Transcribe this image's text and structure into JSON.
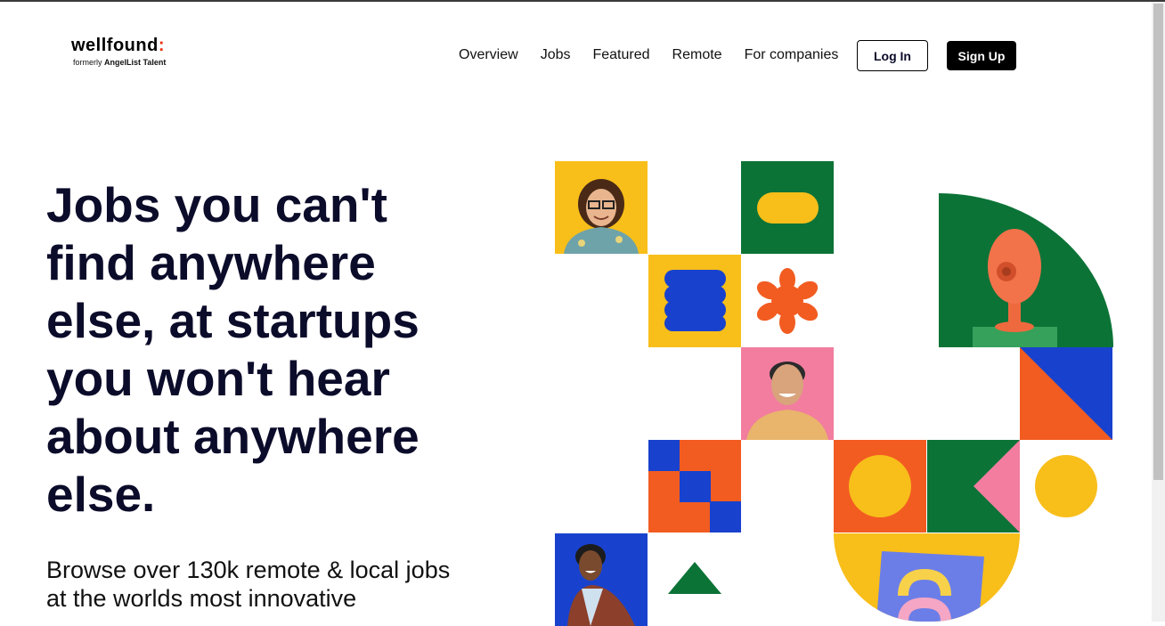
{
  "logo": {
    "word": "wellfound",
    "colon": ":",
    "sub_prefix": "formerly ",
    "sub_brand": "AngelList Talent"
  },
  "nav": {
    "items": [
      "Overview",
      "Jobs",
      "Featured",
      "Remote",
      "For companies"
    ]
  },
  "auth": {
    "login_label": "Log In",
    "signup_label": "Sign Up"
  },
  "hero": {
    "title": "Jobs you can't find anywhere else, at startups you won't hear about anywhere else.",
    "subtitle": "Browse over 130k remote & local jobs at the worlds most innovative"
  },
  "colors": {
    "yellow": "#f8be1a",
    "green": "#0c7337",
    "blue": "#1842cd",
    "orange": "#f25c21",
    "pink": "#f27d9f"
  }
}
